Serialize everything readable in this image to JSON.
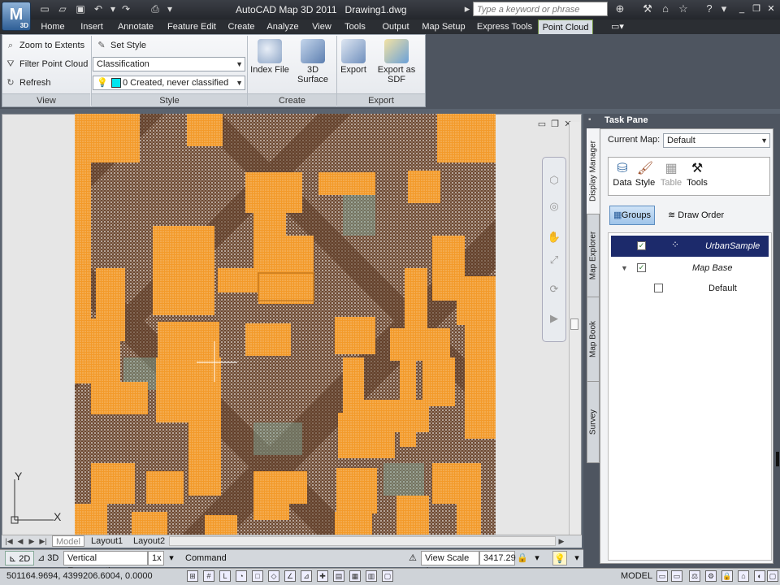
{
  "titlebar": {
    "app_title": "AutoCAD Map 3D 2011",
    "document": "Drawing1.dwg",
    "search_placeholder": "Type a keyword or phrase",
    "app_logo_letter": "M",
    "app_logo_sub": "3D"
  },
  "ribbon_tabs": [
    "Home",
    "Insert",
    "Annotate",
    "Feature Edit",
    "Create",
    "Analyze",
    "View",
    "Tools",
    "Output",
    "Map Setup",
    "Express Tools",
    "Point Cloud"
  ],
  "ribbon": {
    "view_panel": {
      "title": "View",
      "buttons": [
        "Zoom to Extents",
        "Filter Point Cloud",
        "Refresh"
      ]
    },
    "style_panel": {
      "title": "Style",
      "set_style": "Set Style",
      "style_combo": "Classification",
      "class_combo": "0 Created, never classified",
      "class_color": "#00e5ee"
    },
    "create_panel": {
      "title": "Create",
      "buttons": [
        "Index File",
        "3D Surface"
      ]
    },
    "export_panel": {
      "title": "Export",
      "buttons": [
        "Export",
        "Export as SDF"
      ]
    }
  },
  "layout_tabs": [
    "Model",
    "Layout1",
    "Layout2"
  ],
  "status_toolbar": {
    "mode_2d": "2D",
    "mode_3d": "3D",
    "vertical_exaggeration_label": "Vertical Exaggeration:",
    "vertical_exaggeration_value": "1x",
    "command_label": "Command",
    "view_scale_label": "View Scale",
    "view_scale_prefix": "1 :",
    "view_scale_value": "3417.29"
  },
  "statusbar": {
    "coordinates": "501164.9694, 4399206.6004, 0.0000",
    "model_label": "MODEL"
  },
  "task_pane": {
    "title": "Task Pane",
    "side_tabs": [
      "Display Manager",
      "Map Explorer",
      "Map Book",
      "Survey"
    ],
    "current_map_label": "Current Map:",
    "current_map_value": "Default",
    "tools": [
      {
        "label": "Data",
        "icon": "database-icon",
        "enabled": true
      },
      {
        "label": "Style",
        "icon": "brush-icon",
        "enabled": true
      },
      {
        "label": "Table",
        "icon": "table-icon",
        "enabled": false
      },
      {
        "label": "Tools",
        "icon": "tools-icon",
        "enabled": true
      }
    ],
    "groups_label": "Groups",
    "draw_order_label": "Draw Order",
    "layers": [
      {
        "name": "UrbanSample",
        "checked": true,
        "selected": true
      },
      {
        "name": "Map Base",
        "checked": true,
        "expanded": true
      },
      {
        "name": "Default",
        "checked": false
      }
    ]
  },
  "ucs": {
    "y_label": "Y",
    "x_label": "X"
  },
  "colors": {
    "accent_green": "#6b8f3a",
    "selection_navy": "#1c2a6b",
    "point_orange": "#f39a2a",
    "point_brown": "#6e4a33",
    "point_teal": "#7fa89a"
  }
}
